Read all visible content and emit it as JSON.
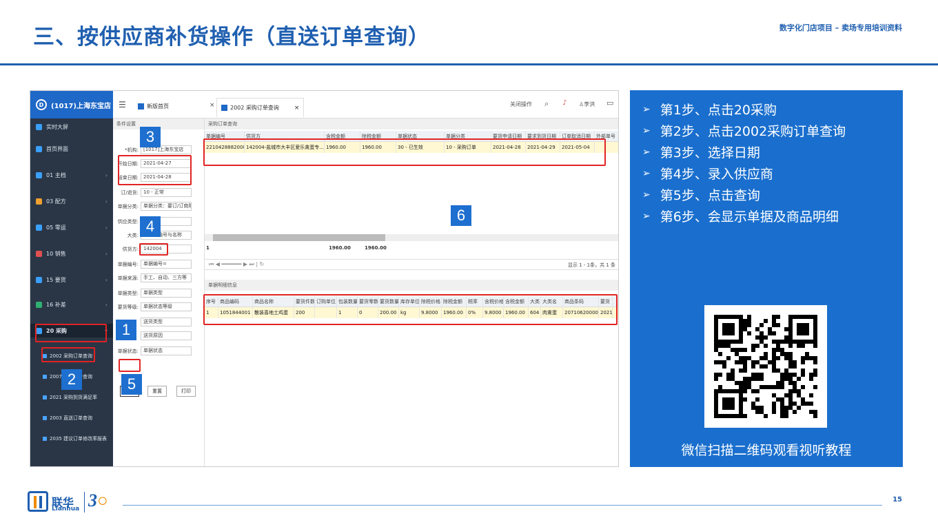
{
  "slide": {
    "title": "三、按供应商补货操作（直送订单查询）",
    "subtitle": "数字化门店项目 – 卖场专用培训资料",
    "page_number": "15",
    "brand_cn": "联华",
    "brand_en": "Lianhua"
  },
  "app": {
    "store_name": "(1017)上海东宝店",
    "tabs": [
      {
        "label": "新版首页"
      },
      {
        "label": "2002 采购订单查询"
      }
    ],
    "top_right": {
      "close_op": "关闭操作",
      "user": "李洪"
    },
    "sidebar": [
      {
        "label": "实时大屏",
        "color": "#3aa0ff"
      },
      {
        "label": "首页界面",
        "color": "#3aa0ff"
      },
      {
        "label": "01 主档",
        "color": "#3aa0ff"
      },
      {
        "label": "03 配方",
        "color": "#f0a030"
      },
      {
        "label": "05 零运",
        "color": "#3aa0ff"
      },
      {
        "label": "10 销售",
        "color": "#e05050"
      },
      {
        "label": "15 要货",
        "color": "#3aa0ff"
      },
      {
        "label": "16 补差",
        "color": "#30b070"
      },
      {
        "label": "20 采购",
        "color": "#3aa0ff"
      }
    ],
    "sub_menu": [
      {
        "label": "2002 采购订单查询"
      },
      {
        "label": "2007 采购综合查询"
      },
      {
        "label": "2021 采购到货满足率"
      },
      {
        "label": "2003 直送订单查询"
      },
      {
        "label": "2035 建议订单修改率报表"
      }
    ],
    "cond_panel": {
      "title": "条件设置",
      "fields": [
        {
          "label": "*机构:",
          "value": "[1017]上海东宝店"
        },
        {
          "label": "开始日期:",
          "value": "2021-04-27"
        },
        {
          "label": "结束日期:",
          "value": "2021-04-28"
        },
        {
          "label": "订/退货:",
          "value": "10 - 正常"
        },
        {
          "label": "单据分类:",
          "value": "单据分类：要订/订南阳"
        },
        {
          "label": "供应类型:",
          "value": "中转等"
        },
        {
          "label": "大类:",
          "value": "请输入编号与名称"
        },
        {
          "label": "供货方:",
          "value": "142004"
        },
        {
          "label": "单据编号:",
          "value": "单据编号="
        },
        {
          "label": "单据来源:",
          "value": "手工、自动、三方等"
        },
        {
          "label": "单据类型:",
          "value": "单据类型"
        },
        {
          "label": "要货等级:",
          "value": "单据状态等级"
        },
        {
          "label": "",
          "value": "送货类型"
        },
        {
          "label": "",
          "value": "送货原因"
        },
        {
          "label": "单据状态:",
          "value": "单据状态"
        }
      ],
      "buttons": {
        "query": "查询",
        "reset": "重置",
        "print": "打印"
      }
    },
    "grid_title": "采购订单查询",
    "order_table": {
      "headers": [
        "单据编号",
        "供货方",
        "含税金额",
        "除税金额",
        "单据状态",
        "单据分类",
        "要货申请日期",
        "要求到货日期",
        "订单取消日期",
        "外部单号"
      ],
      "rows": [
        [
          "2210428882000...",
          "142004-盐城市大丰区爱乐禽蛋专...",
          "1960.00",
          "1960.00",
          "30 - 已生效",
          "10 - 采购订单",
          "2021-04-28",
          "2021-04-29",
          "2021-05-04",
          ""
        ]
      ],
      "summary": {
        "count": "1",
        "tax_amount": "1960.00",
        "net_amount": "1960.00"
      },
      "paging": "显示 1 - 1条，共 1 条"
    },
    "detail_title": "单据明细信息",
    "detail_table": {
      "headers": [
        "序号",
        "商品编码",
        "商品名称",
        "要货件数",
        "订购单位",
        "包装数量",
        "要货零数",
        "要货数量",
        "库存单位",
        "除税价格",
        "除税金额",
        "税率",
        "含税价格",
        "含税金额",
        "大类",
        "大类名",
        "商品条码",
        "要货"
      ],
      "rows": [
        [
          "1",
          "1051844001",
          "散装喜地土鸡蛋",
          "200",
          "",
          "1",
          "0",
          "200.00",
          "kg",
          "9.8000",
          "1960.00",
          "0%",
          "9.8000",
          "1960.00",
          "604",
          "肉禽蛋",
          "2071062000000",
          "2021"
        ]
      ]
    }
  },
  "badges": [
    "1",
    "2",
    "3",
    "4",
    "5",
    "6"
  ],
  "steps": [
    "第1步、点击20采购",
    "第2步、点击2002采购订单查询",
    "第3步、选择日期",
    "第4步、录入供应商",
    "第5步、点击查询",
    "第6步、会显示单据及商品明细"
  ],
  "qr_caption": "微信扫描二维码观看视听教程",
  "colors": {
    "brand_blue": "#1f5fb0",
    "panel_blue": "#1a6fce",
    "highlight_red": "#e12323"
  }
}
